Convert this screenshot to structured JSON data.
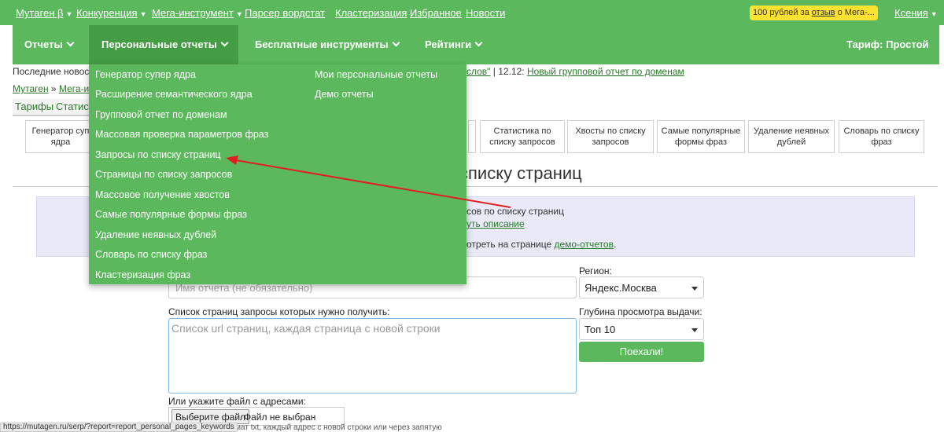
{
  "topbar": {
    "links": [
      {
        "label": "Мутаген β",
        "chevron": true
      },
      {
        "label": "Конкуренция",
        "chevron": true
      },
      {
        "label": "Мега-инструмент",
        "chevron": true
      },
      {
        "label": "Парсер вордстат",
        "chevron": false
      },
      {
        "label": "Кластеризация",
        "chevron": false
      },
      {
        "label": "Избранное",
        "chevron": false
      },
      {
        "label": "Новости",
        "chevron": false
      }
    ],
    "promo": {
      "prefix": "100 рублей за ",
      "link": "отзыв",
      "suffix": " о Мега-..."
    },
    "user": "Ксения",
    "chevron_glyph": "▼"
  },
  "mainnav": {
    "items": [
      {
        "label": "Отчеты"
      },
      {
        "label": "Персональные отчеты"
      },
      {
        "label": "Бесплатные инструменты"
      },
      {
        "label": "Рейтинги"
      }
    ],
    "tariff": "Тариф: Простой"
  },
  "news": {
    "prefix": "Последние новост",
    "link_partial": "слов\"",
    "sep": " | 12.12: ",
    "link2": "Новый групповой отчет по доменам"
  },
  "breadcrumb": {
    "root": "Мутаген",
    "sep": " » ",
    "current": "Мега-ин"
  },
  "subtabs": [
    "Тарифы",
    "Статисти"
  ],
  "tools": [
    "Генератор суп ядра",
    "Статистика по списку запросов",
    "Хвосты по списку запросов",
    "Самые популярные формы фраз",
    "Удаление неявных дублей",
    "Словарь по списку фраз"
  ],
  "page": {
    "heading": "списку страниц"
  },
  "info": {
    "line1": "сов по списку страниц",
    "line2_link": "уть описание",
    "line3_prefix": "отреть на странице ",
    "line3_link": "демо-отчетов",
    "line3_suffix": "."
  },
  "form": {
    "name_placeholder": "Имя отчета (не обязательно)",
    "region_label": "Регион:",
    "region_value": "Яндекс.Москва",
    "urls_label": "Список страниц запросы которых нужно получить:",
    "urls_placeholder": "Список url страниц, каждая страница с новой строки",
    "depth_label": "Глубина просмотра выдачи:",
    "depth_value": "Топ 10",
    "submit": "Поехали!",
    "file_label": "Или укажите файл с адресами:",
    "file_button": "Выберите файл",
    "file_status": "Файл не выбран",
    "file_hint": "ормат txt, каждый адрес с новой строки или через запятую"
  },
  "statusbar": {
    "url": "https://mutagen.ru/serp/?report=report_personal_pages_keywords"
  },
  "dropdown": {
    "left": [
      "Генератор супер ядра",
      "Расширение семантического ядра",
      "Групповой отчет по доменам",
      "Массовая проверка параметров фраз",
      "Запросы по списку страниц",
      "Страницы по списку запросов",
      "Массовое получение хвостов",
      "Самые популярные формы фраз",
      "Удаление неявных дублей",
      "Словарь по списку фраз",
      "Кластеризация фраз"
    ],
    "right": [
      "Мои персональные отчеты",
      "Демо отчеты"
    ]
  },
  "colors": {
    "brand_green": "#5cb85c",
    "active_green": "#449d44",
    "promo_yellow": "#fde231",
    "arrow_red": "#e02020"
  }
}
